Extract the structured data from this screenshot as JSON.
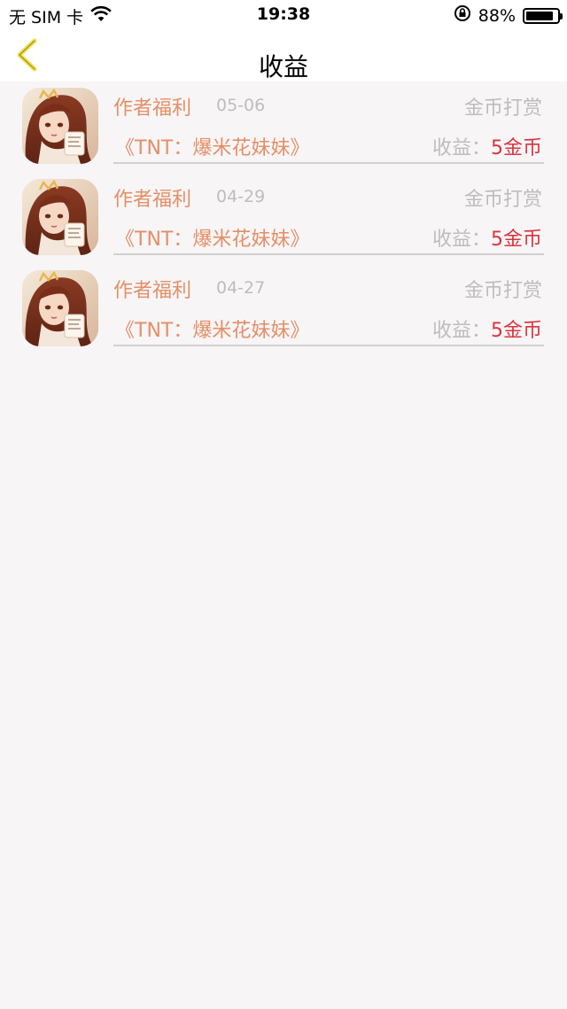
{
  "status_bar": {
    "carrier": "无 SIM 卡",
    "time": "19:38",
    "battery_percent_text": "88%",
    "battery_level": 0.88
  },
  "nav": {
    "title": "收益",
    "back_icon": "chevron-left-icon",
    "accent_color": "#f2e04a"
  },
  "colors": {
    "primary_text": "#e48f66",
    "muted_text": "#bdbdbd",
    "earnings_value": "#d9343e"
  },
  "records": [
    {
      "type": "作者福利",
      "date": "05-06",
      "category": "金币打赏",
      "book": "《TNT：爆米花妹妹》",
      "earn_label": "收益：",
      "earn_value": "5金币"
    },
    {
      "type": "作者福利",
      "date": "04-29",
      "category": "金币打赏",
      "book": "《TNT：爆米花妹妹》",
      "earn_label": "收益：",
      "earn_value": "5金币"
    },
    {
      "type": "作者福利",
      "date": "04-27",
      "category": "金币打赏",
      "book": "《TNT：爆米花妹妹》",
      "earn_label": "收益：",
      "earn_value": "5金币"
    }
  ]
}
